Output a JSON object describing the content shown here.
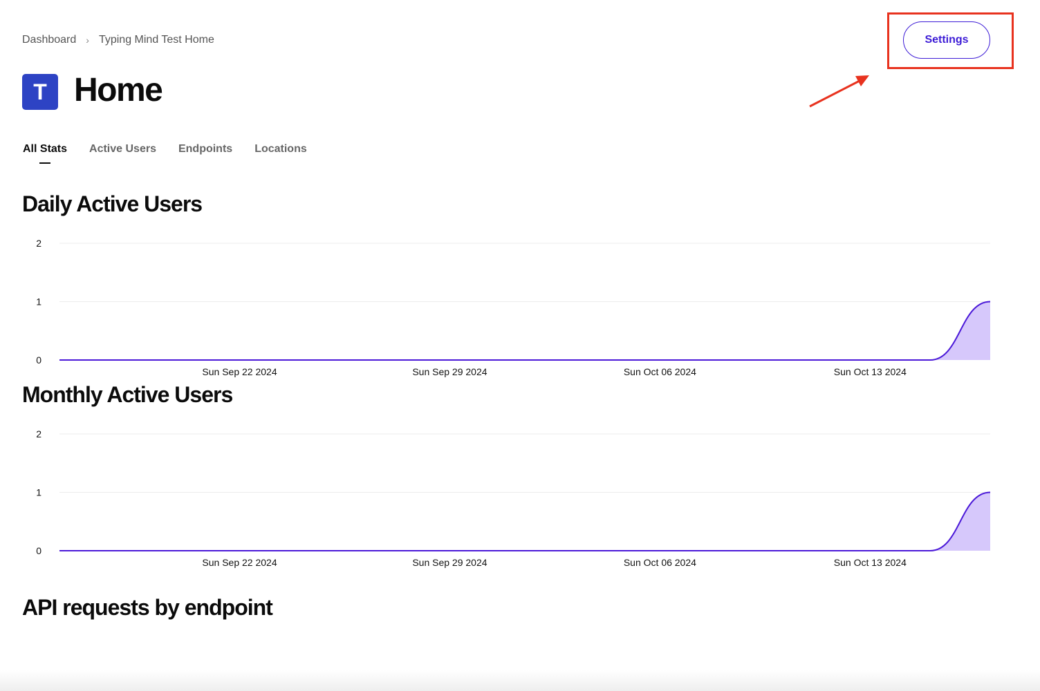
{
  "breadcrumb": {
    "items": [
      "Dashboard",
      "Typing Mind Test Home"
    ]
  },
  "header": {
    "avatar_letter": "T",
    "title": "Home",
    "settings_label": "Settings"
  },
  "tabs": [
    {
      "label": "All Stats",
      "active": true
    },
    {
      "label": "Active Users",
      "active": false
    },
    {
      "label": "Endpoints",
      "active": false
    },
    {
      "label": "Locations",
      "active": false
    }
  ],
  "sections": {
    "dau_title": "Daily Active Users",
    "mau_title": "Monthly Active Users",
    "api_title": "API requests by endpoint"
  },
  "colors": {
    "accent": "#3d1cd6",
    "line": "#4a18d8",
    "area": "#d6c8fb",
    "annotation": "#e8321e",
    "avatar": "#2d43c4"
  },
  "chart_data": [
    {
      "type": "area",
      "x_start": "2024-09-16",
      "x_end": "2024-10-17",
      "x_tick_labels": [
        "Sun Sep 22 2024",
        "Sun Sep 29 2024",
        "Sun Oct 06 2024",
        "Sun Oct 13 2024"
      ],
      "x_tick_dates": [
        "2024-09-22",
        "2024-09-29",
        "2024-10-06",
        "2024-10-13"
      ],
      "y_ticks": [
        0,
        1,
        2
      ],
      "ylim": [
        0,
        2
      ],
      "grid": true,
      "points": [
        {
          "x": "2024-09-16",
          "y": 0
        },
        {
          "x": "2024-10-15",
          "y": 0
        },
        {
          "x": "2024-10-17",
          "y": 1
        }
      ]
    },
    {
      "type": "area",
      "x_start": "2024-09-16",
      "x_end": "2024-10-17",
      "x_tick_labels": [
        "Sun Sep 22 2024",
        "Sun Sep 29 2024",
        "Sun Oct 06 2024",
        "Sun Oct 13 2024"
      ],
      "x_tick_dates": [
        "2024-09-22",
        "2024-09-29",
        "2024-10-06",
        "2024-10-13"
      ],
      "y_ticks": [
        0,
        1,
        2
      ],
      "ylim": [
        0,
        2
      ],
      "grid": true,
      "points": [
        {
          "x": "2024-09-16",
          "y": 0
        },
        {
          "x": "2024-10-15",
          "y": 0
        },
        {
          "x": "2024-10-17",
          "y": 1
        }
      ]
    }
  ]
}
